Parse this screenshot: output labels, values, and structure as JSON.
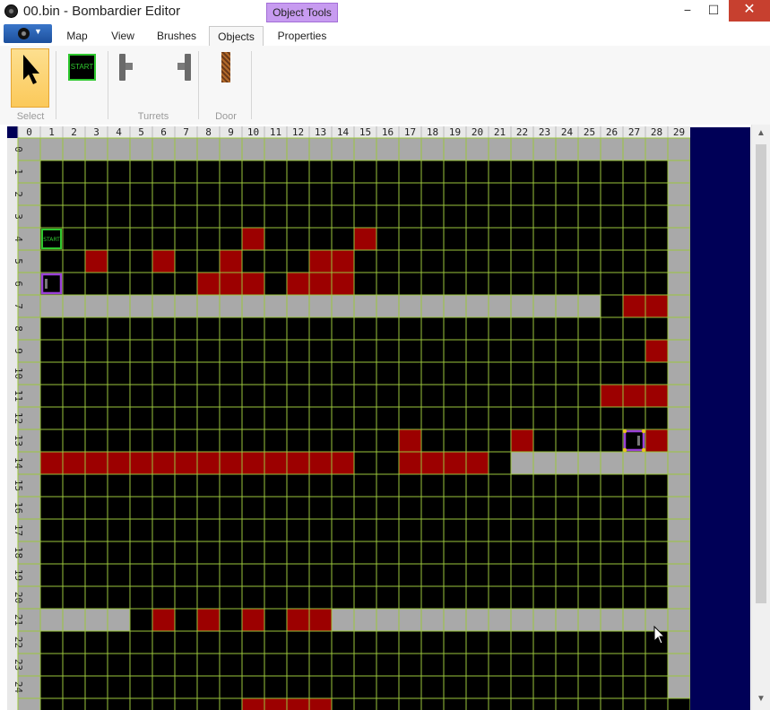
{
  "window": {
    "title": "00.bin - Bombardier Editor",
    "contextual_tab_header": "Object Tools",
    "controls": {
      "minimize": "−",
      "maximize": "☐",
      "close": "✕"
    }
  },
  "app_menu": {
    "caret": "▼"
  },
  "tabs": [
    {
      "label": "Map",
      "active": false
    },
    {
      "label": "View",
      "active": false
    },
    {
      "label": "Brushes",
      "active": false
    },
    {
      "label": "Objects",
      "active": true
    },
    {
      "label": "Properties",
      "active": false
    }
  ],
  "ribbon": {
    "groups": {
      "select": "Select",
      "turrets": "Turrets",
      "door": "Door"
    },
    "start_tool_label": "START"
  },
  "map": {
    "columns": 30,
    "visible_rows": 25,
    "col_labels": [
      "0",
      "1",
      "2",
      "3",
      "4",
      "5",
      "6",
      "7",
      "8",
      "9",
      "10",
      "11",
      "12",
      "13",
      "14",
      "15",
      "16",
      "17",
      "18",
      "19",
      "20",
      "21",
      "22",
      "23",
      "24",
      "25",
      "26",
      "27",
      "28",
      "29"
    ],
    "row_labels": [
      "0",
      "1",
      "2",
      "3",
      "4",
      "5",
      "6",
      "7",
      "8",
      "9",
      "10",
      "11",
      "12",
      "13",
      "14",
      "15",
      "16",
      "17",
      "18",
      "19",
      "20",
      "21",
      "22",
      "23",
      "24"
    ],
    "tile_codes": {
      ".": "empty",
      "#": "wall",
      "R": "hazard"
    },
    "colors": {
      "empty": "#000000",
      "wall": "#a9a9a9",
      "hazard": "#9c0000",
      "gridline": "#9ac53d",
      "header": "#e8e8e8",
      "header_text": "#222222",
      "start": "#2fc82f",
      "turret": "#9a40d8",
      "selection_handle": "#e6c21a"
    },
    "rows": [
      "##############################",
      "#............................#",
      "#............................#",
      "#............................#",
      "#.........R....R.............#",
      "#..R..R..R...RR..............#",
      "#.......RRR.RRR..............#",
      "##########################.RR#",
      "#............................#",
      "#...........................R#",
      "#............................#",
      "#.........................RRR#",
      "#............................#",
      "#................R....R.....R#",
      "#RRRRRRRRRRRRRR..RRRR.########",
      "#............................#",
      "#............................#",
      "#............................#",
      "#............................#",
      "#............................#",
      "#............................#",
      "#####.R.R.R.RR################",
      "#............................#",
      "#............................#",
      "#............................#"
    ],
    "partial_next_row": "#.........RRRR................",
    "objects": [
      {
        "type": "start",
        "label": "START",
        "col": 1,
        "row": 4
      },
      {
        "type": "turret-right",
        "col": 1,
        "row": 6
      },
      {
        "type": "turret-left",
        "col": 27,
        "row": 13,
        "selected": true
      }
    ]
  }
}
